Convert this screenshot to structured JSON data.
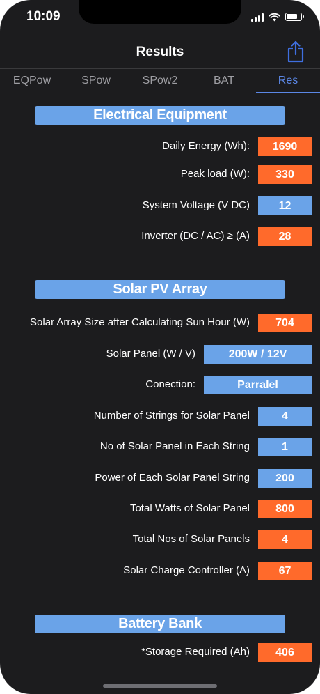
{
  "status_bar": {
    "time": "10:09"
  },
  "nav": {
    "title": "Results"
  },
  "tabs": [
    {
      "label": "EQPow",
      "active": false
    },
    {
      "label": "SPow",
      "active": false
    },
    {
      "label": "SPow2",
      "active": false
    },
    {
      "label": "BAT",
      "active": false
    },
    {
      "label": "Res",
      "active": true
    }
  ],
  "sections": {
    "electrical": {
      "title": "Electrical Equipment",
      "rows": [
        {
          "label": "Daily Energy (Wh):",
          "value": "1690",
          "color": "#ff6a2b"
        },
        {
          "label": "Peak load (W):",
          "value": "330",
          "color": "#ff6a2b"
        },
        {
          "label": "System Voltage (V DC)",
          "value": "12",
          "color": "#6aa3e8"
        },
        {
          "label": "Inverter (DC / AC) ≥ (A)",
          "value": "28",
          "color": "#ff6a2b"
        }
      ]
    },
    "solar": {
      "title": "Solar PV Array",
      "rows": [
        {
          "label": "Solar Array Size after Calculating Sun Hour  (W)",
          "value": "704",
          "color": "#ff6a2b"
        },
        {
          "label": "Solar Panel (W / V)",
          "value": "200W / 12V",
          "color": "#6aa3e8"
        },
        {
          "label": "Conection:",
          "value": "Parralel",
          "color": "#6aa3e8"
        },
        {
          "label": "Number of Strings for Solar Panel",
          "value": "4",
          "color": "#6aa3e8"
        },
        {
          "label": "No of Solar Panel in Each String",
          "value": "1",
          "color": "#6aa3e8"
        },
        {
          "label": "Power of Each Solar Panel String",
          "value": "200",
          "color": "#6aa3e8"
        },
        {
          "label": "Total Watts of Solar Panel",
          "value": "800",
          "color": "#ff6a2b"
        },
        {
          "label": "Total Nos of Solar Panels",
          "value": "4",
          "color": "#ff6a2b"
        },
        {
          "label": "Solar Charge Controller (A)",
          "value": "67",
          "color": "#ff6a2b"
        }
      ]
    },
    "battery": {
      "title": "Battery Bank",
      "rows": [
        {
          "label": "*Storage Required (Ah)",
          "value": "406",
          "color": "#ff6a2b"
        }
      ]
    }
  },
  "icons": {
    "share": "share-icon",
    "wifi": "wifi-icon",
    "battery": "battery-icon",
    "signal": "signal-icon"
  },
  "colors": {
    "accent": "#5b87e6",
    "orange": "#ff6a2b",
    "blue": "#6aa3e8",
    "background": "#1c1c1e"
  }
}
